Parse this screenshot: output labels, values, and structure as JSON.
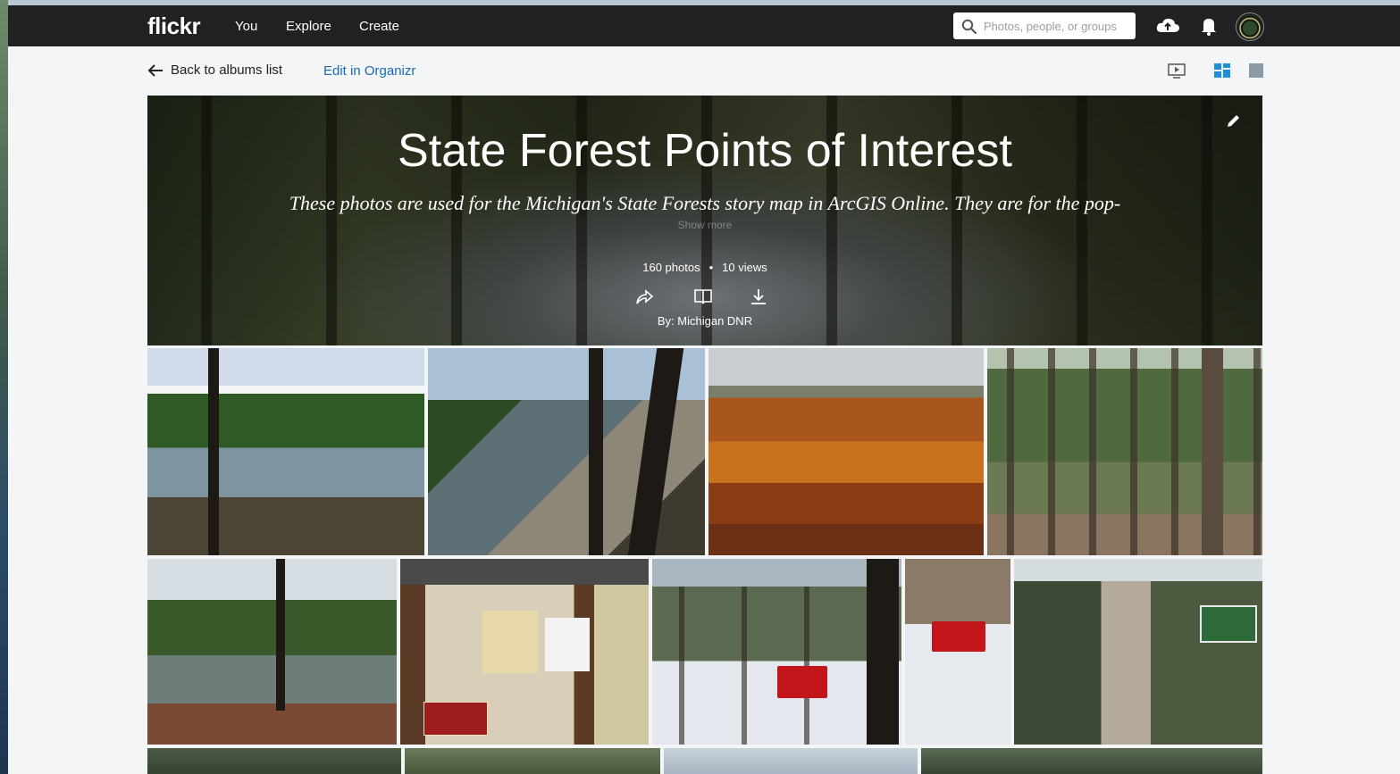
{
  "nav": {
    "logo": "flickr",
    "items": [
      {
        "label": "You"
      },
      {
        "label": "Explore"
      },
      {
        "label": "Create"
      }
    ],
    "search_placeholder": "Photos, people, or groups"
  },
  "subnav": {
    "back_label": "Back to albums list",
    "organizr_label": "Edit in Organizr"
  },
  "album": {
    "title": "State Forest Points of Interest",
    "description": "These photos are used for the Michigan's State Forests story map in ArcGIS Online. They are for the pop-",
    "show_more": "Show more",
    "photo_count": "160 photos",
    "separator": "•",
    "views": "10 views",
    "by_line": "By: Michigan DNR"
  },
  "photos": [
    {
      "subject": "lake shoreline with pine trees"
    },
    {
      "subject": "rocky lakeshore through trees"
    },
    {
      "subject": "autumn forest canopy"
    },
    {
      "subject": "pine forest trail"
    },
    {
      "subject": "lake with birch trees"
    },
    {
      "subject": "trailhead kiosk with sign"
    },
    {
      "subject": "snow groomer in forest"
    },
    {
      "subject": "snow groomer close-up"
    },
    {
      "subject": "dirt road with recreation area sign"
    },
    {
      "subject": "forest"
    },
    {
      "subject": "forest"
    },
    {
      "subject": "sky"
    },
    {
      "subject": "forest"
    }
  ],
  "colors": {
    "topbar": "#212124",
    "link": "#1c6ab5",
    "active_view": "#1c8fd6"
  }
}
